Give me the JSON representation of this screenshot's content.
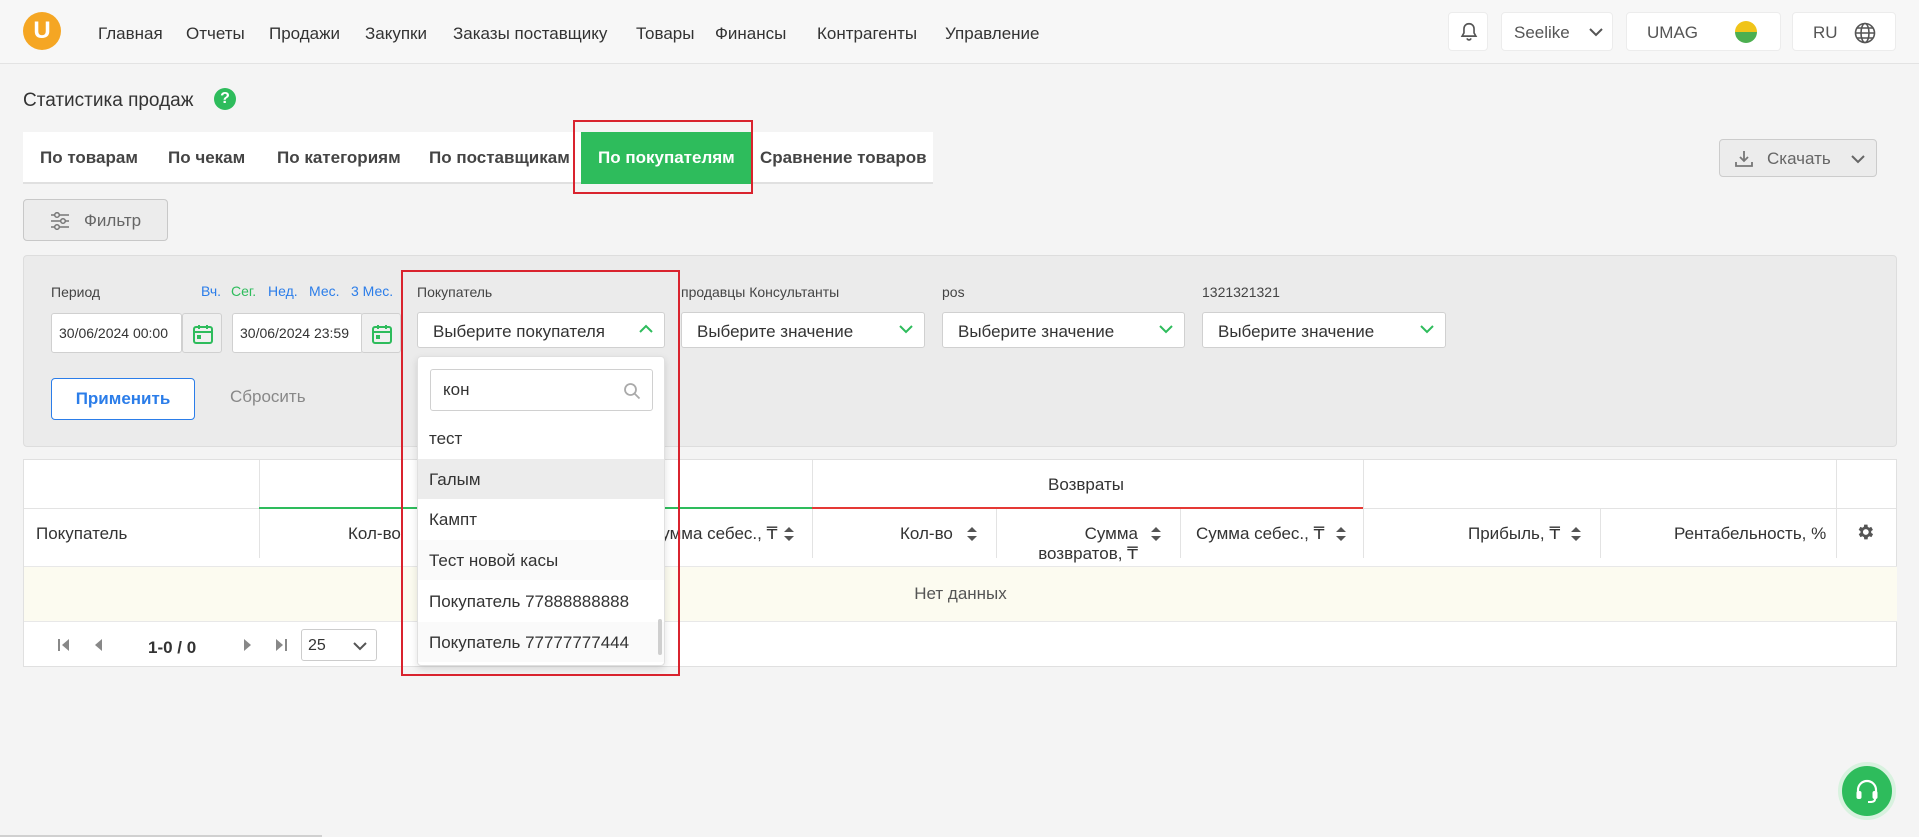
{
  "header": {
    "logo_letter": "U",
    "nav": [
      "Главная",
      "Отчеты",
      "Продажи",
      "Закупки",
      "Заказы поставщику",
      "Товары",
      "Финансы",
      "Контрагенты",
      "Управление"
    ],
    "store": "Seelike",
    "company": "UMAG",
    "language": "RU"
  },
  "page": {
    "title": "Статистика продаж",
    "help": "?"
  },
  "tabs": [
    "По товарам",
    "По чекам",
    "По категориям",
    "По поставщикам",
    "По покупателям",
    "Сравнение товаров"
  ],
  "active_tab": "По покупателям",
  "download_label": "Скачать",
  "filter_label": "Фильтр",
  "filters": {
    "period_label": "Период",
    "quick": [
      "Вч.",
      "Сег.",
      "Нед.",
      "Мес.",
      "3 Мес."
    ],
    "date_from": "30/06/2024 00:00",
    "date_to": "30/06/2024 23:59",
    "buyer_label": "Покупатель",
    "buyer_placeholder": "Выберите покупателя",
    "sellers_label": "продавцы Консультанты",
    "sellers_value": "Выберите значение",
    "pos_label": "pos",
    "pos_value": "Выберите значение",
    "custom_label": "1321321321",
    "custom_value": "Выберите значение",
    "apply": "Применить",
    "reset": "Сбросить"
  },
  "dropdown": {
    "search_value": "кон",
    "items": [
      "тест",
      "Галым",
      "Кампт",
      "Тест новой касы",
      "Покупатель 77888888888",
      "Покупатель 77777777444"
    ]
  },
  "table": {
    "group_returns": "Возвраты",
    "col_buyer": "Покупатель",
    "col_qty": "Кол-во",
    "col_cost_sum": "Сумма себес., ₸",
    "col_ret_qty": "Кол-во",
    "col_ret_sum": "Сумма возвратов, ₸",
    "col_ret_cost": "Сумма себес., ₸",
    "col_profit": "Прибыль, ₸",
    "col_margin": "Рентабельность, %",
    "empty": "Нет данных"
  },
  "pager": {
    "info": "1-0 / 0",
    "page_size": "25"
  },
  "colors": {
    "accent_green": "#2ebc5c",
    "link_blue": "#2b7de9",
    "highlight_red": "#d9232e",
    "logo_orange": "#f5a623"
  }
}
